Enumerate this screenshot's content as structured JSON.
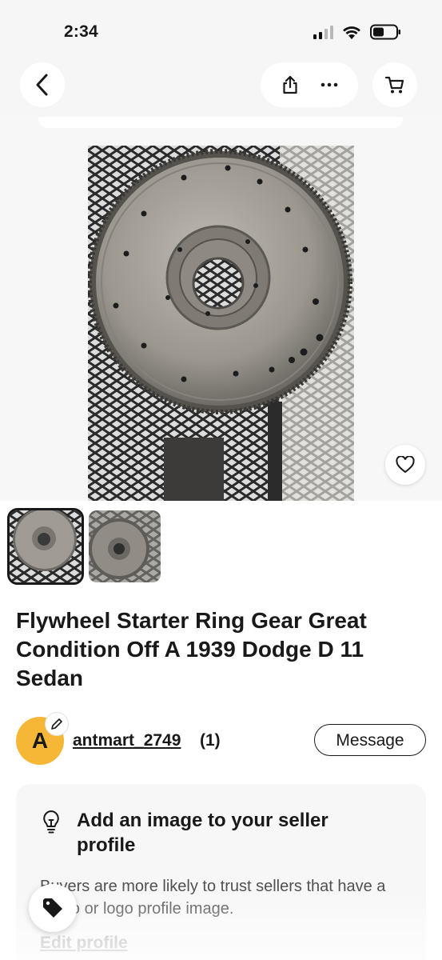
{
  "status_bar": {
    "time": "2:34",
    "signal_icon": "cellular-signal-icon",
    "wifi_icon": "wifi-icon",
    "battery_icon": "battery-icon"
  },
  "nav": {
    "back_icon": "chevron-left-icon",
    "share_icon": "share-icon",
    "more_icon": "more-horizontal-icon",
    "cart_icon": "cart-icon"
  },
  "listing": {
    "title": "Flywheel Starter Ring Gear Great Condition Off A 1939 Dodge D 11 Sedan",
    "image_count": 2,
    "selected_image": 1,
    "watch_icon": "heart-icon"
  },
  "seller": {
    "avatar_letter": "A",
    "name": "antmart_2749",
    "feedback": "(1)",
    "message_label": "Message",
    "avatar_color": "#f5b735"
  },
  "promo": {
    "icon": "lightbulb-icon",
    "title": "Add an image to your seller profile",
    "text": "Buyers are more likely to trust sellers that have a photo or logo profile image.",
    "link": "Edit profile"
  },
  "fab": {
    "icon": "tag-icon"
  }
}
